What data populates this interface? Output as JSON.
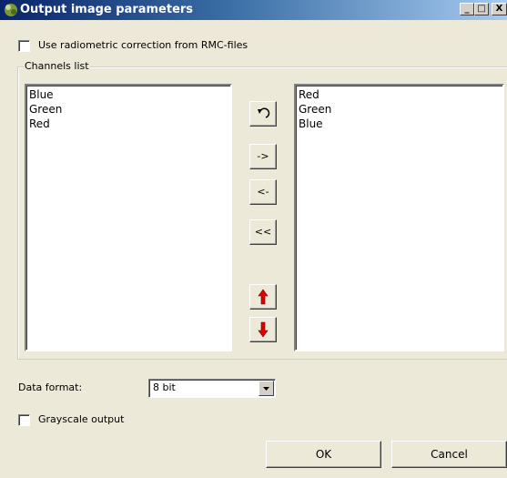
{
  "window": {
    "title": "Output image parameters",
    "minimize_glyph": "_",
    "maximize_glyph": "□",
    "close_glyph": "X"
  },
  "radiometric_checkbox": {
    "label": "Use radiometric correction from RMC-files",
    "checked": false
  },
  "channels": {
    "group_label": "Channels list",
    "available": [
      "Blue",
      "Green",
      "Red"
    ],
    "selected": [
      "Red",
      "Green",
      "Blue"
    ]
  },
  "buttons": {
    "reset_icon": "undo-arrow-icon",
    "add_label": "->",
    "remove_label": "<-",
    "remove_all_label": "<<",
    "move_up_icon": "red-up-arrow-icon",
    "move_down_icon": "red-down-arrow-icon"
  },
  "data_format": {
    "label": "Data format:",
    "value": "8 bit"
  },
  "grayscale_checkbox": {
    "label": "Grayscale output",
    "checked": false
  },
  "footer": {
    "ok_label": "OK",
    "cancel_label": "Cancel"
  },
  "colors": {
    "title_start": "#0a246a",
    "title_end": "#a6caf0",
    "face": "#ece9d8",
    "arrow_red": "#e00000"
  }
}
